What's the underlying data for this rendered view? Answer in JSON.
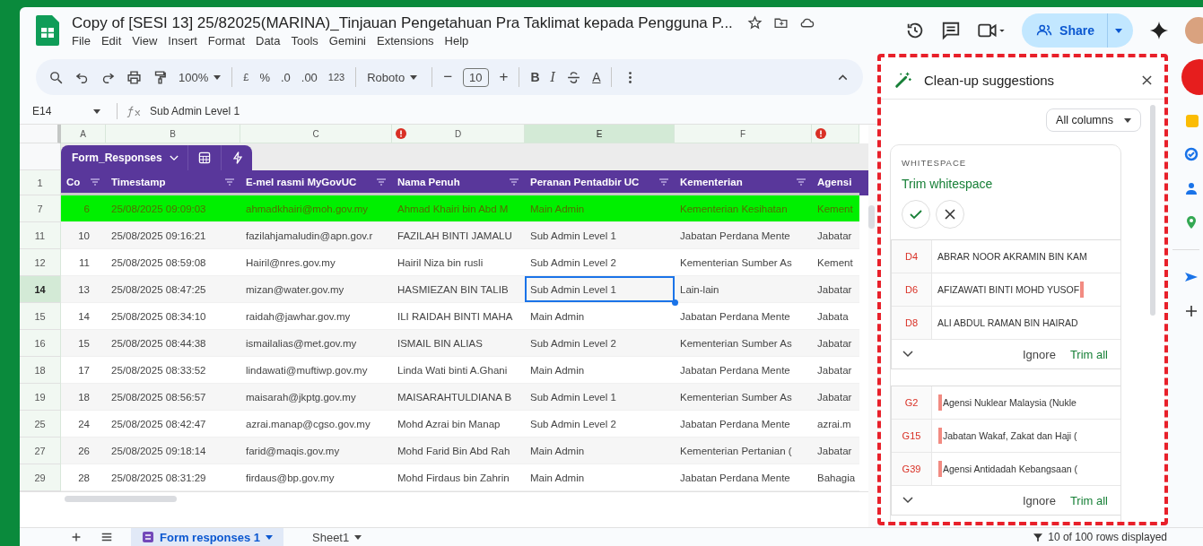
{
  "document": {
    "title": "Copy of [SESI 13] 25/82025(MARINA)_Tinjauan Pengetahuan Pra Taklimat kepada Pengguna P...",
    "menu": [
      "File",
      "Edit",
      "View",
      "Insert",
      "Format",
      "Data",
      "Tools",
      "Gemini",
      "Extensions",
      "Help"
    ],
    "share_label": "Share"
  },
  "toolbar": {
    "zoom": "100%",
    "currency": "£",
    "percent": "%",
    "decrease_decimal": ".0",
    "increase_decimal": ".00",
    "number_format": "123",
    "font": "Roboto",
    "minus": "−",
    "font_size": "10",
    "plus": "+",
    "bold": "B",
    "italic": "I",
    "text_color": "A"
  },
  "formula_bar": {
    "cell": "E14",
    "value": "Sub Admin Level 1"
  },
  "grid": {
    "columns": [
      {
        "letter": "A",
        "selected": false,
        "error": false
      },
      {
        "letter": "B",
        "selected": false,
        "error": false
      },
      {
        "letter": "C",
        "selected": false,
        "error": false
      },
      {
        "letter": "D",
        "selected": false,
        "error": true
      },
      {
        "letter": "E",
        "selected": true,
        "error": false
      },
      {
        "letter": "F",
        "selected": false,
        "error": false
      },
      {
        "selected": false,
        "error": true
      }
    ],
    "table_name": "Form_Responses",
    "headers": [
      "Co",
      "Timestamp",
      "E-mel rasmi MyGovUC",
      "Nama Penuh",
      "Peranan Pentadbir UC",
      "Kementerian",
      "Agensi"
    ],
    "header_row": "1",
    "rows": [
      {
        "num": "7",
        "highlighted": true,
        "selected": false,
        "cells": [
          "6",
          "25/08/2025 09:09:03",
          "ahmadkhairi@moh.gov.my",
          "Ahmad Khairi bin Abd M",
          "Main Admin",
          "Kementerian Kesihatan",
          "Kement"
        ]
      },
      {
        "num": "11",
        "highlighted": false,
        "selected": false,
        "cells": [
          "10",
          "25/08/2025 09:16:21",
          "fazilahjamaludin@apn.gov.r",
          "FAZILAH BINTI JAMALU",
          "Sub Admin Level 1",
          "Jabatan Perdana Mente",
          "Jabatar"
        ]
      },
      {
        "num": "12",
        "highlighted": false,
        "selected": false,
        "cells": [
          "11",
          "25/08/2025 08:59:08",
          "Hairil@nres.gov.my",
          "Hairil Niza bin rusli",
          "Sub Admin Level 2",
          "Kementerian Sumber As",
          "Kement"
        ]
      },
      {
        "num": "14",
        "highlighted": false,
        "selected": true,
        "cells": [
          "13",
          "25/08/2025 08:47:25",
          "mizan@water.gov.my",
          "HASMIEZAN BIN TALIB",
          "Sub Admin Level 1",
          "Lain-lain",
          "Jabatar"
        ]
      },
      {
        "num": "15",
        "highlighted": false,
        "selected": false,
        "cells": [
          "14",
          "25/08/2025 08:34:10",
          "raidah@jawhar.gov.my",
          "ILI RAIDAH BINTI MAHA",
          "Main Admin",
          "Jabatan Perdana Mente",
          "Jabata"
        ]
      },
      {
        "num": "16",
        "highlighted": false,
        "selected": false,
        "cells": [
          "15",
          "25/08/2025 08:44:38",
          "ismailalias@met.gov.my",
          "ISMAIL BIN ALIAS",
          "Sub Admin Level 2",
          "Kementerian Sumber As",
          "Jabatar"
        ]
      },
      {
        "num": "18",
        "highlighted": false,
        "selected": false,
        "cells": [
          "17",
          "25/08/2025 08:33:52",
          "lindawati@muftiwp.gov.my",
          "Linda Wati binti A.Ghani",
          "Main Admin",
          "Jabatan Perdana Mente",
          "Jabatar"
        ]
      },
      {
        "num": "19",
        "highlighted": false,
        "selected": false,
        "cells": [
          "18",
          "25/08/2025 08:56:57",
          "maisarah@jkptg.gov.my",
          "MAISARAHTULDIANA B",
          "Sub Admin Level 1",
          "Kementerian Sumber As",
          "Jabatar"
        ]
      },
      {
        "num": "25",
        "highlighted": false,
        "selected": false,
        "cells": [
          "24",
          "25/08/2025 08:42:47",
          "azrai.manap@cgso.gov.my",
          "Mohd Azrai bin Manap",
          "Sub Admin Level 2",
          "Jabatan Perdana Mente",
          "azrai.m"
        ]
      },
      {
        "num": "27",
        "highlighted": false,
        "selected": false,
        "cells": [
          "26",
          "25/08/2025 09:18:14",
          "farid@maqis.gov.my",
          "Mohd Farid Bin Abd Rah",
          "Main Admin",
          "Kementerian Pertanian (",
          "Jabatar"
        ]
      },
      {
        "num": "29",
        "highlighted": false,
        "selected": false,
        "cells": [
          "28",
          "25/08/2025 08:31:29",
          "firdaus@bp.gov.my",
          "Mohd Firdaus bin Zahrin",
          "Main Admin",
          "Jabatan Perdana Mente",
          "Bahagia"
        ]
      }
    ]
  },
  "sheet_tabs": [
    {
      "label": "Form responses 1",
      "selected": true
    },
    {
      "label": "Sheet1",
      "selected": false
    }
  ],
  "rows_displayed": "10 of 100 rows displayed",
  "cleanup": {
    "title": "Clean-up suggestions",
    "filter": "All columns",
    "category": "WHITESPACE",
    "suggestion": "Trim whitespace",
    "groups": [
      {
        "ignore": "Ignore",
        "apply": "Trim all",
        "items": [
          {
            "cell": "D4",
            "text": "ABRAR NOOR AKRAMIN BIN KAM",
            "kind": "plain"
          },
          {
            "cell": "D6",
            "text": "AFIZAWATI BINTI MOHD YUSOF",
            "kind": "trailing"
          },
          {
            "cell": "D8",
            "text": "ALI ABDUL RAMAN BIN HAIRAD",
            "kind": "plain"
          }
        ]
      },
      {
        "ignore": "Ignore",
        "apply": "Trim all",
        "items": [
          {
            "cell": "G2",
            "text": "Agensi Nuklear Malaysia (Nukle",
            "kind": "leading"
          },
          {
            "cell": "G15",
            "text": "Jabatan Wakaf, Zakat dan Haji (",
            "kind": "leading"
          },
          {
            "cell": "G39",
            "text": "Agensi Antidadah Kebangsaan (",
            "kind": "leading"
          }
        ]
      }
    ]
  }
}
